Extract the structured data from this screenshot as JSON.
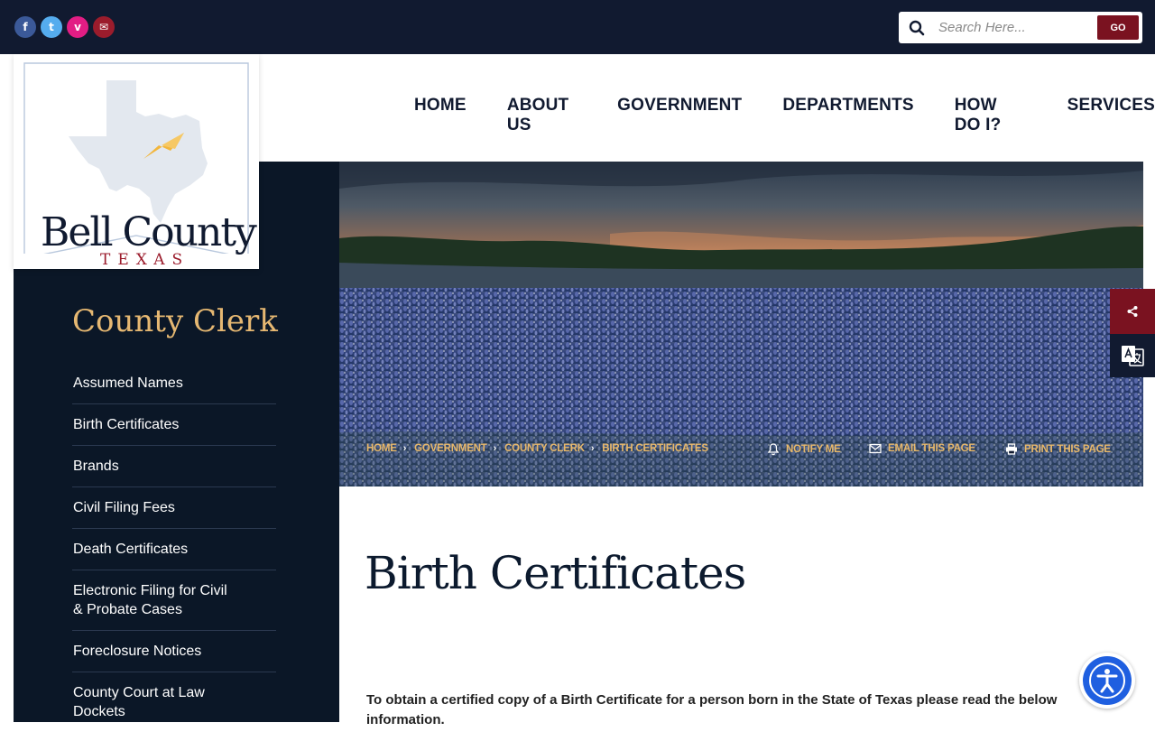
{
  "social": {
    "icons": [
      "facebook-icon",
      "twitter-icon",
      "vimeo-icon",
      "envelope-icon"
    ],
    "colors": [
      "#3b5998",
      "#55acee",
      "#e21d84",
      "#9b1c2c"
    ],
    "facebook": "f",
    "twitter": "t",
    "vimeo": "v",
    "email": "✉"
  },
  "search": {
    "placeholder": "Search Here...",
    "go_label": "GO"
  },
  "logo": {
    "line1": "Bell County",
    "line2": "TEXAS"
  },
  "nav": {
    "home": "HOME",
    "about": "ABOUT US",
    "government": "GOVERNMENT",
    "departments": "DEPARTMENTS",
    "howdoi": "HOW DO I?",
    "services": "SERVICES"
  },
  "sidebar": {
    "title": "County Clerk",
    "items": [
      "Assumed Names",
      "Birth Certificates",
      "Brands",
      "Civil Filing Fees",
      "Death Certificates",
      "Electronic Filing for Civil & Probate Cases",
      "Foreclosure Notices",
      "County Court at Law Dockets"
    ]
  },
  "breadcrumb": [
    "HOME",
    "GOVERNMENT",
    "COUNTY CLERK",
    "BIRTH CERTIFICATES"
  ],
  "tools": {
    "notify": "NOTIFY ME",
    "email": "EMAIL THIS PAGE",
    "print": "PRINT THIS PAGE"
  },
  "page": {
    "title": "Birth Certificates",
    "intro": "To obtain a certified copy of a Birth Certificate for a person born in the State of Texas please read the below information."
  },
  "colors": {
    "navy": "#111a30",
    "maroon": "#7a1220",
    "gold": "#e6b872",
    "accessibility": "#1f5fe0"
  }
}
